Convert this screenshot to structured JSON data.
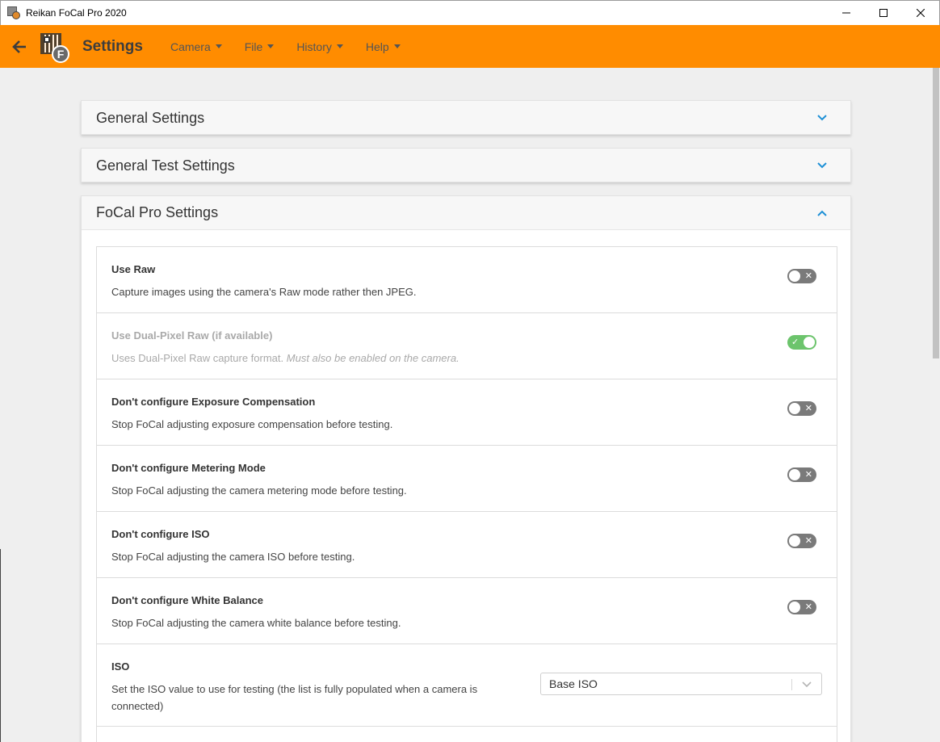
{
  "window": {
    "title": "Reikan FoCal Pro 2020"
  },
  "header": {
    "page_title": "Settings",
    "menu": [
      {
        "label": "Camera"
      },
      {
        "label": "File"
      },
      {
        "label": "History"
      },
      {
        "label": "Help"
      }
    ],
    "logo_letter": "F",
    "accent_color": "#ff8c00"
  },
  "panels": {
    "general": {
      "title": "General Settings"
    },
    "general_test": {
      "title": "General Test Settings"
    },
    "focal_pro": {
      "title": "FoCal Pro Settings"
    }
  },
  "settings": [
    {
      "title": "Use Raw",
      "desc": "Capture images using the camera's Raw mode rather then JPEG.",
      "enabled": false
    },
    {
      "title": "Use Dual-Pixel Raw (if available)",
      "desc": "Uses Dual-Pixel Raw capture format.",
      "desc_em": "Must also be enabled on the camera.",
      "enabled": true,
      "disabled_row": true
    },
    {
      "title": "Don't configure Exposure Compensation",
      "desc": "Stop FoCal adjusting exposure compensation before testing.",
      "enabled": false
    },
    {
      "title": "Don't configure Metering Mode",
      "desc": "Stop FoCal adjusting the camera metering mode before testing.",
      "enabled": false
    },
    {
      "title": "Don't configure ISO",
      "desc": "Stop FoCal adjusting the camera ISO before testing.",
      "enabled": false
    },
    {
      "title": "Don't configure White Balance",
      "desc": "Stop FoCal adjusting the camera white balance before testing.",
      "enabled": false
    }
  ],
  "iso": {
    "title": "ISO",
    "desc": "Set the ISO value to use for testing (the list is fully populated when a camera is connected)",
    "selected": "Base ISO"
  },
  "toggle_marks": {
    "off": "✕",
    "on": "✓"
  }
}
